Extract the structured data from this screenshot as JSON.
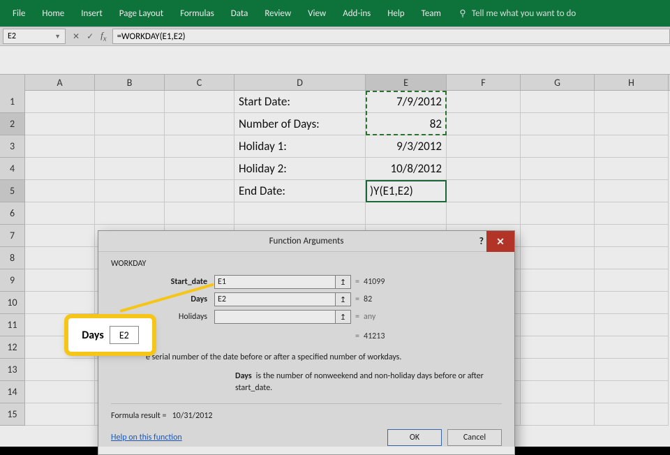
{
  "ribbon": {
    "tabs": [
      "File",
      "Home",
      "Insert",
      "Page Layout",
      "Formulas",
      "Data",
      "Review",
      "View",
      "Add-ins",
      "Help",
      "Team"
    ],
    "tell": "Tell me what you want to do"
  },
  "namebox": "E2",
  "formula": "=WORKDAY(E1,E2)",
  "columns": [
    "A",
    "B",
    "C",
    "D",
    "E",
    "F",
    "G",
    "H"
  ],
  "rows": [
    "1",
    "2",
    "3",
    "4",
    "5",
    "6",
    "7",
    "8",
    "9",
    "10",
    "11",
    "12",
    "13",
    "14",
    "15"
  ],
  "cells": {
    "D1": "Start Date:",
    "E1": "7/9/2012",
    "D2": "Number of Days:",
    "E2": "82",
    "D3": "Holiday 1:",
    "E3": "9/3/2012",
    "D4": "Holiday 2:",
    "E4": "10/8/2012",
    "D5": "End Date:",
    "E5": ")Y(E1,E2)"
  },
  "dialog": {
    "title": "Function Arguments",
    "fn": "WORKDAY",
    "args": [
      {
        "label": "Start_date",
        "bold": true,
        "value": "E1",
        "result": "41099"
      },
      {
        "label": "Days",
        "bold": true,
        "value": "E2",
        "result": "82"
      },
      {
        "label": "Holidays",
        "bold": false,
        "value": "",
        "result": "any"
      }
    ],
    "equals_result": "41213",
    "desc1_suffix": "e serial number of the date before or after a specified number of workdays.",
    "desc2_label": "Days",
    "desc2_text": "is the number of nonweekend and non-holiday days before or after start_date.",
    "formula_result_label": "Formula result =",
    "formula_result": "10/31/2012",
    "help_link": "Help on this function",
    "ok": "OK",
    "cancel": "Cancel"
  },
  "callout": {
    "label": "Days",
    "value": "E2"
  }
}
